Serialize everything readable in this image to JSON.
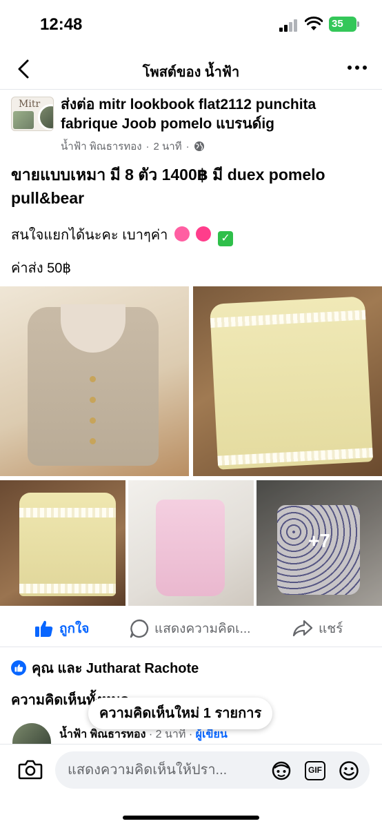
{
  "status_bar": {
    "time": "12:48",
    "battery": "35"
  },
  "header": {
    "title": "โพสต์ของ น้ำฟ้า",
    "back_icon": "chevron-left-icon",
    "more_icon": "more-dots-icon"
  },
  "post": {
    "avatar_text": "Mitr",
    "heading": "ส่งต่อ mitr lookbook flat2112 punchita fabrique Joob pomelo แบรนด์ig",
    "author": "น้ำฟ้า พิณธารทอง",
    "time": "2 นาที",
    "privacy_icon": "globe-icon",
    "line1": "ขายแบบเหมา มี 8 ตัว 1400฿ มี duex pomelo pull&bear",
    "line2": "สนใจแยกได้นะคะ เบาๆค่า",
    "line3": "ค่าส่ง 50฿",
    "more_photos": "+7"
  },
  "actions": {
    "like": "ถูกใจ",
    "comment": "แสดงความคิดเ...",
    "share": "แชร์"
  },
  "reactions": {
    "text": "คุณ และ Jutharat Rachote"
  },
  "comments": {
    "title": "ความคิดเห็นทั้งหมด",
    "new_pill": "ความคิดเห็นใหม่ 1 รายการ",
    "first_author": "น้ำฟ้า พิณธารทอง",
    "first_time": "2 นาที",
    "first_badge": "ผู้เขียน"
  },
  "composer": {
    "placeholder": "แสดงความคิดเห็นให้ปรา...",
    "gif": "GIF",
    "icons": [
      "camera-icon",
      "avatar-sticker-icon",
      "gif-icon",
      "emoji-icon"
    ]
  },
  "colors": {
    "accent": "#0866ff",
    "secondary_text": "#65676b",
    "battery": "#34c759"
  }
}
